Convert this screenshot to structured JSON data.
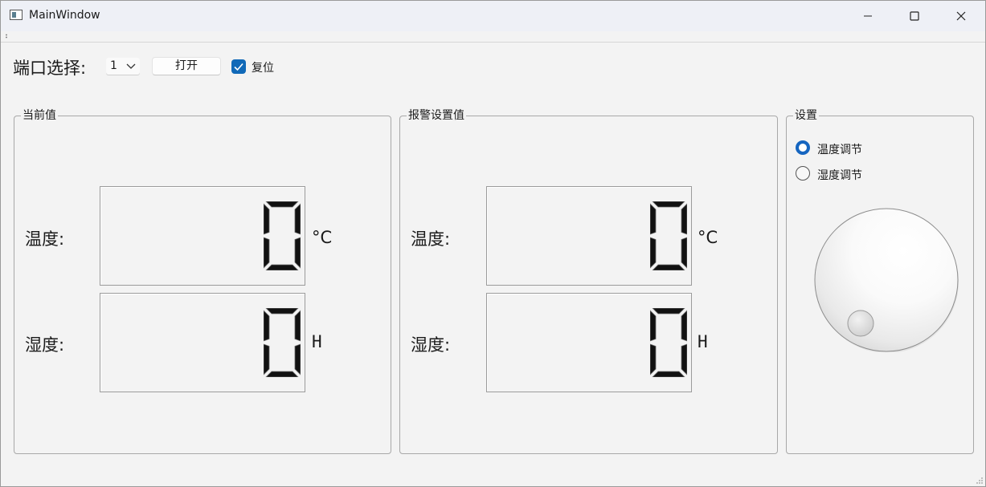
{
  "window": {
    "title": "MainWindow"
  },
  "toolbar": {
    "port_label": "端口选择:",
    "port_value": "1",
    "open_button": "打开",
    "reset_label": "复位",
    "reset_checked": true
  },
  "current": {
    "title": "当前值",
    "temp_label": "温度:",
    "temp_value": "0",
    "temp_unit": "°C",
    "humid_label": "湿度:",
    "humid_value": "0",
    "humid_unit": "H"
  },
  "alarm": {
    "title": "报警设置值",
    "temp_label": "温度:",
    "temp_value": "0",
    "temp_unit": "°C",
    "humid_label": "湿度:",
    "humid_value": "0",
    "humid_unit": "H"
  },
  "settings": {
    "title": "设置",
    "options": [
      {
        "label": "温度调节",
        "selected": true
      },
      {
        "label": "湿度调节",
        "selected": false
      }
    ]
  },
  "icons": {
    "app": "app-window-icon",
    "minimize": "minimize-icon",
    "maximize": "maximize-icon",
    "close": "close-icon",
    "dropdown": "chevron-down-icon",
    "check": "checkmark-icon"
  },
  "colors": {
    "accent": "#1565c0",
    "checkbox": "#1069b8",
    "lcd_digit": "#111111"
  }
}
